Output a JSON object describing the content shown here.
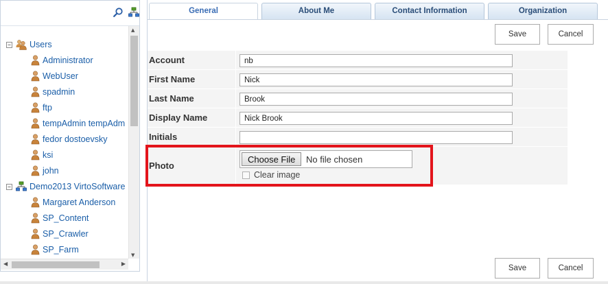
{
  "tree": {
    "nodes": [
      {
        "label": "Users",
        "level": 0,
        "type": "group",
        "expanded": true
      },
      {
        "label": "Administrator",
        "level": 1,
        "type": "user"
      },
      {
        "label": "WebUser",
        "level": 1,
        "type": "user"
      },
      {
        "label": "spadmin",
        "level": 1,
        "type": "user"
      },
      {
        "label": "ftp",
        "level": 1,
        "type": "user"
      },
      {
        "label": "tempAdmin tempAdm",
        "level": 1,
        "type": "user"
      },
      {
        "label": "fedor dostoevsky",
        "level": 1,
        "type": "user"
      },
      {
        "label": "ksi",
        "level": 1,
        "type": "user"
      },
      {
        "label": "john",
        "level": 1,
        "type": "user"
      },
      {
        "label": "Demo2013 VirtoSoftware",
        "level": 0,
        "type": "org",
        "expanded": true
      },
      {
        "label": "Margaret Anderson",
        "level": 1,
        "type": "user"
      },
      {
        "label": "SP_Content",
        "level": 1,
        "type": "user"
      },
      {
        "label": "SP_Crawler",
        "level": 1,
        "type": "user"
      },
      {
        "label": "SP_Farm",
        "level": 1,
        "type": "user"
      }
    ]
  },
  "tabs": [
    {
      "label": "General",
      "active": true
    },
    {
      "label": "About Me",
      "active": false
    },
    {
      "label": "Contact Information",
      "active": false
    },
    {
      "label": "Organization",
      "active": false
    }
  ],
  "actions": {
    "save_label": "Save",
    "cancel_label": "Cancel"
  },
  "form": {
    "account": {
      "label": "Account",
      "value": "nb"
    },
    "first_name": {
      "label": "First Name",
      "value": "Nick"
    },
    "last_name": {
      "label": "Last Name",
      "value": "Brook"
    },
    "display_name": {
      "label": "Display Name",
      "value": "Nick Brook"
    },
    "initials": {
      "label": "Initials",
      "value": ""
    },
    "photo": {
      "label": "Photo",
      "choose_file_label": "Choose File",
      "file_status": "No file chosen",
      "clear_image_label": "Clear image",
      "clear_image_checked": false
    }
  },
  "colors": {
    "link": "#1a5ea8",
    "tab_active_text": "#3a6db5",
    "tab_text": "#2a4d78",
    "highlight": "#e3141b",
    "row_bg": "#f4f4f4"
  },
  "icons": {
    "search": "search-icon",
    "hierarchy": "hierarchy-icon",
    "user": "user-icon",
    "users_group": "users-group-icon",
    "organization": "organization-icon"
  }
}
